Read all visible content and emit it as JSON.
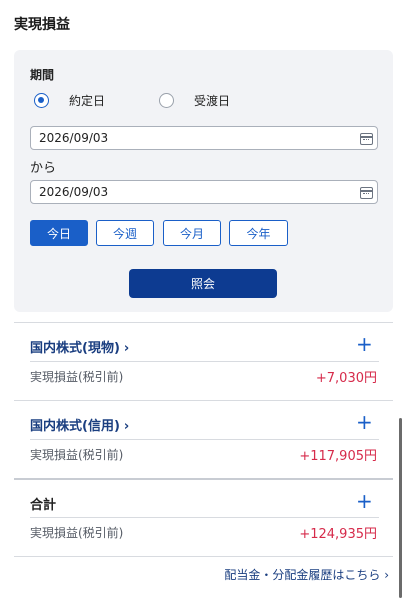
{
  "page": {
    "title": "実現損益"
  },
  "filter": {
    "period_label": "期間",
    "basis_options": [
      {
        "label": "約定日",
        "selected": true
      },
      {
        "label": "受渡日",
        "selected": false
      }
    ],
    "date_from": "2026/09/03",
    "range_separator": "から",
    "date_to": "2026/09/03",
    "quick_buttons": [
      {
        "label": "今日",
        "active": true
      },
      {
        "label": "今週",
        "active": false
      },
      {
        "label": "今月",
        "active": false
      },
      {
        "label": "今年",
        "active": false
      }
    ],
    "query_button": "照会"
  },
  "sections": [
    {
      "title": "国内株式(現物)",
      "chevron": "›",
      "row_label": "実現損益(税引前)",
      "value": "+7,030円",
      "expand": "+"
    },
    {
      "title": "国内株式(信用)",
      "chevron": "›",
      "row_label": "実現損益(税引前)",
      "value": "+117,905円",
      "expand": "+"
    },
    {
      "title": "合計",
      "row_label": "実現損益(税引前)",
      "value": "+124,935円",
      "expand": "+"
    }
  ],
  "footer": {
    "link": "配当金・分配金履歴はこちら ›"
  },
  "colors": {
    "accent": "#1a5fc8",
    "primary_button": "#0d3b91",
    "positive_value": "#d62a4a",
    "panel_bg": "#f2f3f6"
  },
  "icons": [
    "calendar-icon",
    "chevron-right-icon",
    "plus-icon"
  ]
}
